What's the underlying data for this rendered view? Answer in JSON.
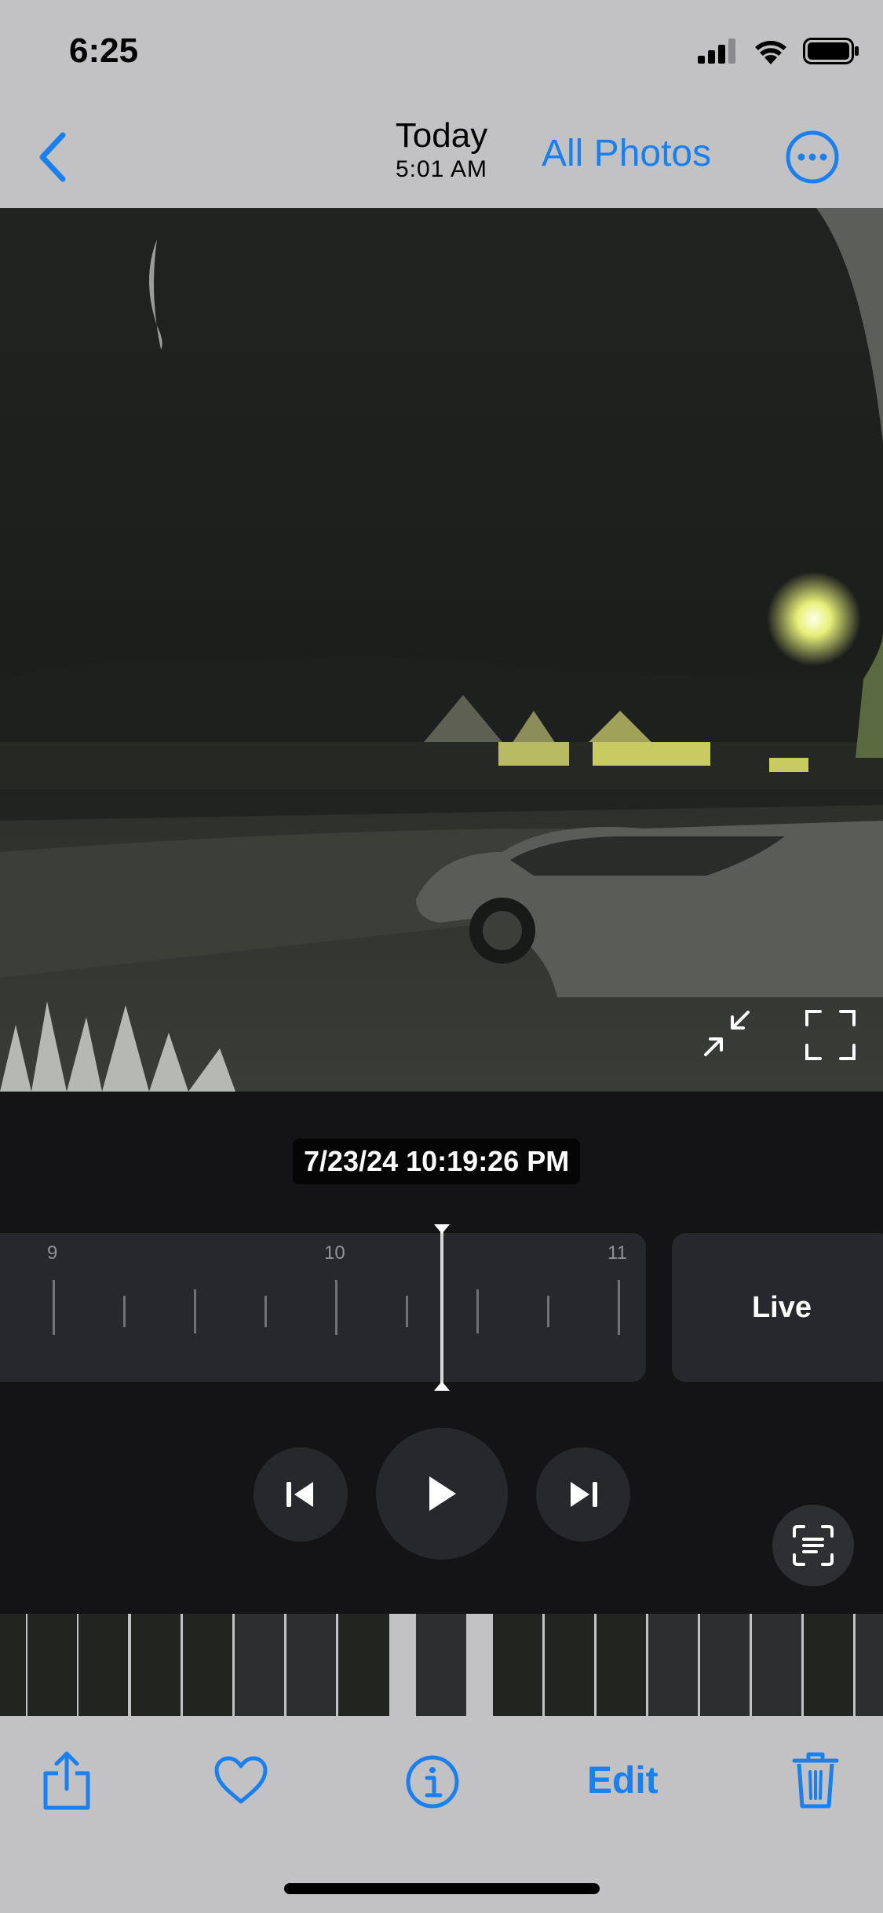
{
  "status_bar": {
    "time": "6:25",
    "icons": [
      "cellular-signal-icon",
      "wifi-icon",
      "battery-icon"
    ]
  },
  "nav_bar": {
    "back_icon": "chevron-left-icon",
    "title": "Today",
    "subtitle": "5:01 AM",
    "all_photos_label": "All Photos",
    "more_icon": "ellipsis-circle-icon"
  },
  "video": {
    "controls": [
      "collapse-arrows-icon",
      "fullscreen-icon"
    ]
  },
  "player": {
    "timestamp": "7/23/24 10:19:26 PM",
    "timeline": {
      "labels": [
        "9",
        "10",
        "11"
      ]
    },
    "live_label": "Live",
    "controls": [
      "skip-back-icon",
      "play-icon",
      "skip-forward-icon"
    ],
    "live_text_icon": "text-scan-icon"
  },
  "toolbar": {
    "share_icon": "share-icon",
    "favorite_icon": "heart-icon",
    "info_icon": "info-icon",
    "edit_label": "Edit",
    "delete_icon": "trash-icon"
  },
  "colors": {
    "accent": "#1a80f0",
    "background": "#c2c2c4",
    "panel": "#141416"
  }
}
